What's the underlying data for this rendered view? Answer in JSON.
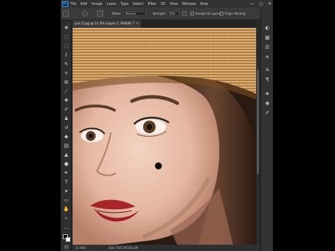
{
  "app": {
    "logo_text": "Ps"
  },
  "menu": [
    "File",
    "Edit",
    "Image",
    "Layer",
    "Type",
    "Select",
    "Filter",
    "3D",
    "View",
    "Window",
    "Help"
  ],
  "window_controls": [
    "—",
    "▢",
    "✕"
  ],
  "options_bar": {
    "mode_label": "Mode:",
    "mode_value": "Normal",
    "strength_label": "Strength:",
    "strength_value": "50%",
    "sample_all_layers": "Sample All Layers",
    "finger_painting": "Finger Painting"
  },
  "document": {
    "tab_title": "pan 2.jpg @ 11.5% (Layer 1, RGB/8) *",
    "tab_close": "×"
  },
  "status": {
    "zoom": "11.46%",
    "doc_size": "Doc: 183.1M/183.1M"
  },
  "tools": [
    "move-tool",
    "artboard-tool",
    "marquee-tool",
    "lasso-tool",
    "quick-select-tool",
    "crop-tool",
    "frame-tool",
    "eyedropper-tool",
    "spot-healing-tool",
    "brush-tool",
    "clone-stamp-tool",
    "history-brush-tool",
    "eraser-tool",
    "gradient-tool",
    "blur-tool",
    "dodge-tool",
    "pen-tool",
    "type-tool",
    "path-select-tool",
    "rectangle-tool",
    "hand-tool",
    "zoom-tool",
    "edit-toolbar"
  ],
  "right_panel_icons": [
    "color-panel-icon",
    "swatches-panel-icon",
    "properties-panel-icon",
    "adjustments-panel-icon",
    "character-panel-icon",
    "paragraph-panel-icon",
    "layers-panel-icon",
    "channels-panel-icon",
    "paths-panel-icon"
  ],
  "colors": {
    "accent": "#31a8ff",
    "foreground": "#000000",
    "background": "#ffffff"
  }
}
